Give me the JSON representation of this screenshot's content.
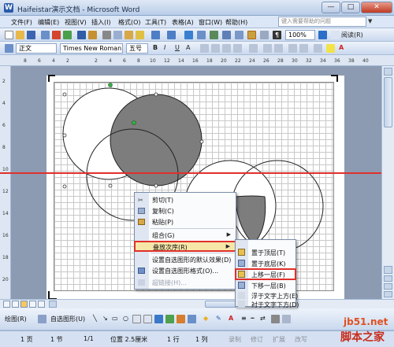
{
  "window": {
    "title": "Haifeistar演示文档 - Microsoft Word",
    "controls": {
      "minimize": "—",
      "maximize": "□",
      "close": "✕"
    }
  },
  "menubar": {
    "items": [
      "文件(F)",
      "编辑(E)",
      "视图(V)",
      "插入(I)",
      "格式(O)",
      "工具(T)",
      "表格(A)",
      "窗口(W)",
      "帮助(H)"
    ],
    "help_placeholder": "键入需要帮助的问题"
  },
  "toolbar_standard": {
    "zoom": "100%",
    "read_label": "阅读(R)"
  },
  "toolbar_format": {
    "style": "正文",
    "font": "Times New Roman",
    "size": "五号"
  },
  "context_menu": {
    "items": [
      {
        "label": "剪切(T)",
        "icon": "scissors-icon",
        "enabled": true
      },
      {
        "label": "复制(C)",
        "icon": "copy-icon",
        "enabled": true
      },
      {
        "label": "粘贴(P)",
        "icon": "paste-icon",
        "enabled": true
      },
      {
        "label": "组合(G)",
        "enabled": true,
        "submenu": true
      },
      {
        "label": "叠放次序(R)",
        "enabled": true,
        "submenu": true,
        "highlighted": true
      },
      {
        "label": "设置自选图形的默认效果(D)",
        "enabled": true
      },
      {
        "label": "设置自选图形格式(O)...",
        "icon": "format-shape-icon",
        "enabled": true
      },
      {
        "label": "超链接(H)...",
        "icon": "hyperlink-icon",
        "enabled": false
      }
    ]
  },
  "submenu_order": {
    "items": [
      {
        "label": "置于顶层(T)",
        "enabled": true
      },
      {
        "label": "置于底层(K)",
        "enabled": true
      },
      {
        "label": "上移一层(F)",
        "enabled": true,
        "highlighted": true
      },
      {
        "label": "下移一层(B)",
        "enabled": true
      },
      {
        "label": "浮于文字上方(E)",
        "enabled": false
      },
      {
        "label": "衬于文字下方(D)",
        "enabled": false
      }
    ]
  },
  "drawbar": {
    "draw_label": "绘图(R)",
    "autoshape_label": "自选图形(U)"
  },
  "status": {
    "page": "1 页",
    "section": "1 节",
    "page_of": "1/1",
    "position": "位置 2.5厘米",
    "line": "1 行",
    "column": "1 列",
    "rec": "录制",
    "trk": "修订",
    "ext": "扩展",
    "ovr": "改写"
  },
  "watermark": {
    "site": "jb51.net",
    "name": "脚本之家"
  },
  "colors": {
    "accent_red": "#e0302a",
    "highlight": "#f6e7a8",
    "fill_gray": "#7d7d7d"
  }
}
